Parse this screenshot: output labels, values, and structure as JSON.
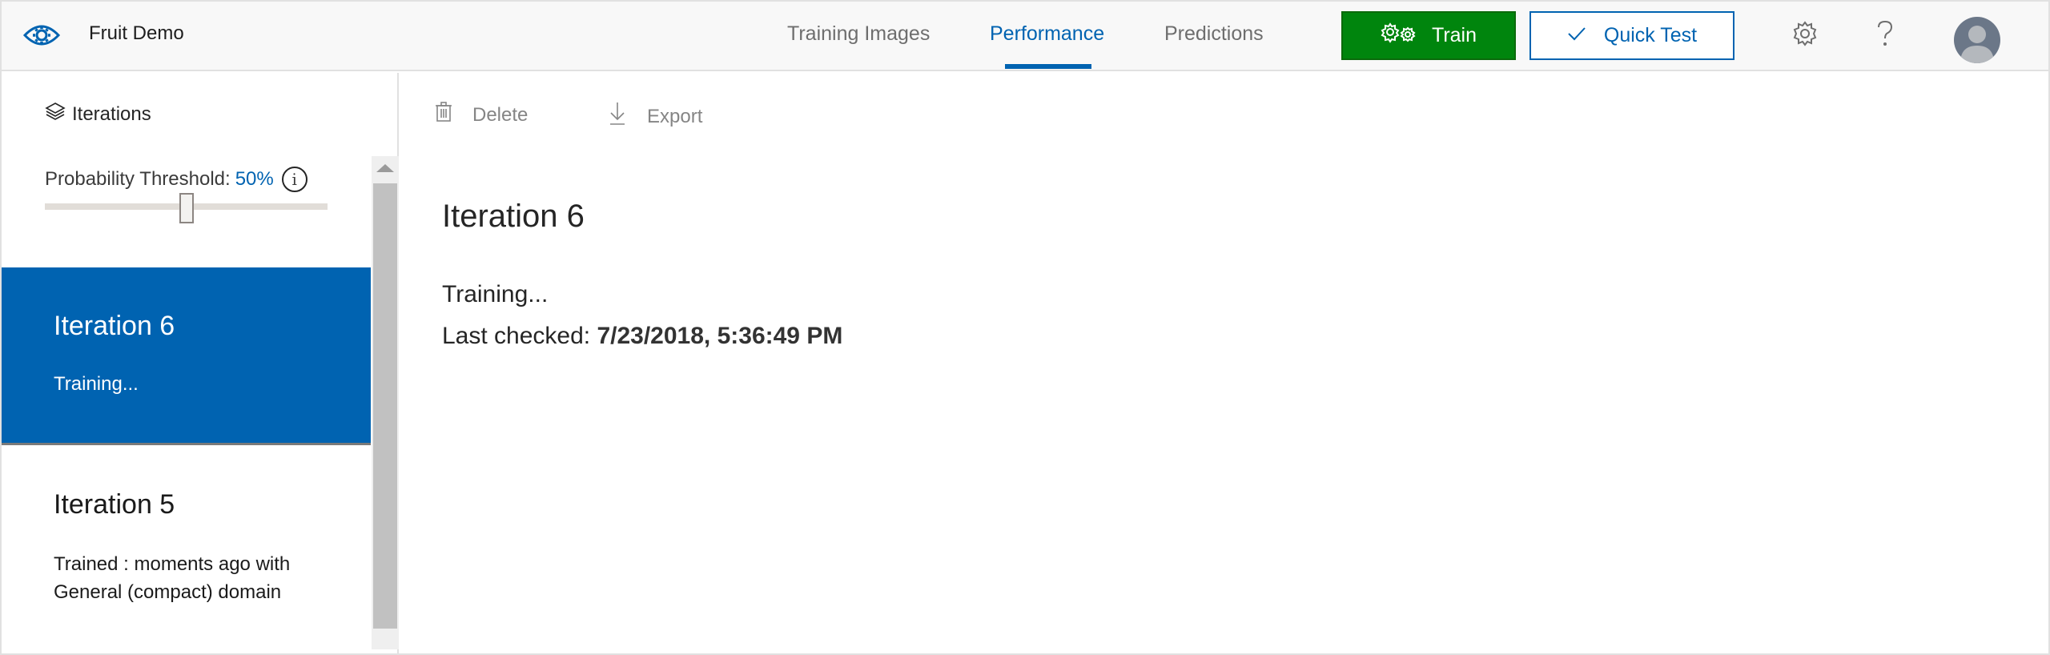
{
  "header": {
    "app_title": "Fruit Demo",
    "logo_icon": "eye-gear-icon",
    "tabs": [
      {
        "label": "Training Images",
        "active": false
      },
      {
        "label": "Performance",
        "active": true
      },
      {
        "label": "Predictions",
        "active": false
      }
    ],
    "train_button": {
      "label": "Train",
      "icon": "gears-icon"
    },
    "quick_test_button": {
      "label": "Quick Test",
      "icon": "checkmark-icon"
    },
    "settings_icon": "gear-icon",
    "help_icon": "question-icon",
    "avatar_icon": "user-avatar-icon"
  },
  "colors": {
    "accent": "#0063b1",
    "train_green": "#00850d",
    "topbar_bg": "#f8f8f8",
    "muted_text": "#858585"
  },
  "sidebar": {
    "header_label": "Iterations",
    "header_icon": "layers-icon",
    "threshold": {
      "label": "Probability Threshold:",
      "value": "50%",
      "value_percent": 50,
      "info_icon": "info-icon"
    },
    "iterations": [
      {
        "title": "Iteration 6",
        "status": "Training...",
        "selected": true
      },
      {
        "title": "Iteration 5",
        "status": "Trained : moments ago with General (compact) domain",
        "selected": false
      }
    ]
  },
  "toolbar": {
    "delete_label": "Delete",
    "delete_icon": "trash-icon",
    "export_label": "Export",
    "export_icon": "download-icon"
  },
  "main": {
    "title": "Iteration 6",
    "status": "Training...",
    "last_checked_label": "Last checked:",
    "last_checked_value": "7/23/2018, 5:36:49 PM"
  }
}
